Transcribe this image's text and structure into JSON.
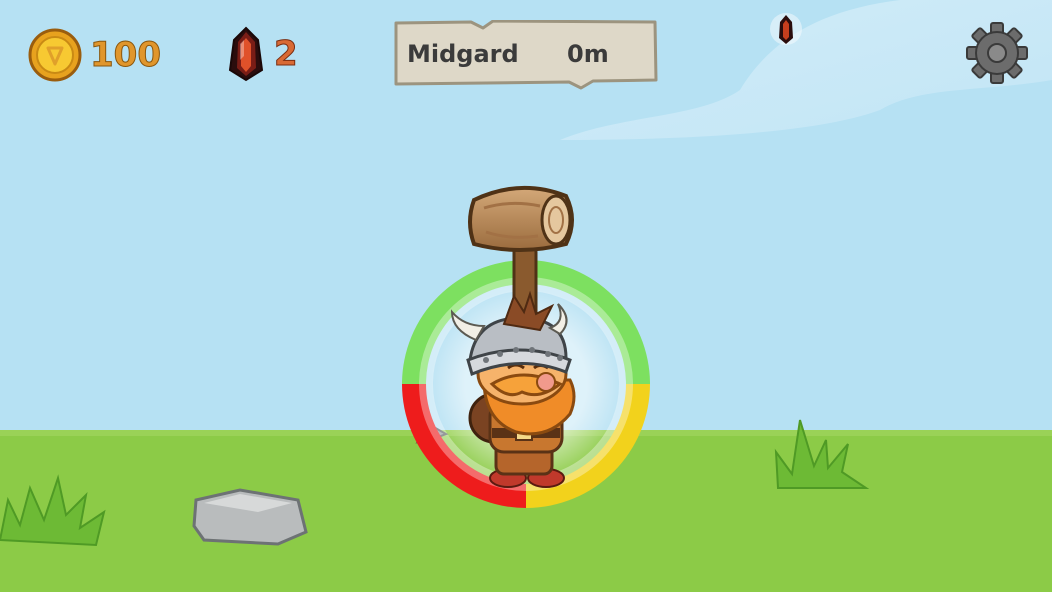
{
  "hud": {
    "coins": "100",
    "gems": "2",
    "location": "Midgard",
    "distance": "0m"
  },
  "icons": {
    "coin": "coin-icon",
    "gem": "crystal-gem-icon",
    "settings": "gear-icon"
  },
  "colors": {
    "sky": "#b6e1f3",
    "grass": "#8ccb47",
    "hud_text": "#e0962c",
    "gem_count": "#d96a34",
    "parchment": "#ded8c8",
    "meter_green": "#7de060",
    "meter_red": "#ee1c1c",
    "meter_yellow": "#f2d21c"
  }
}
